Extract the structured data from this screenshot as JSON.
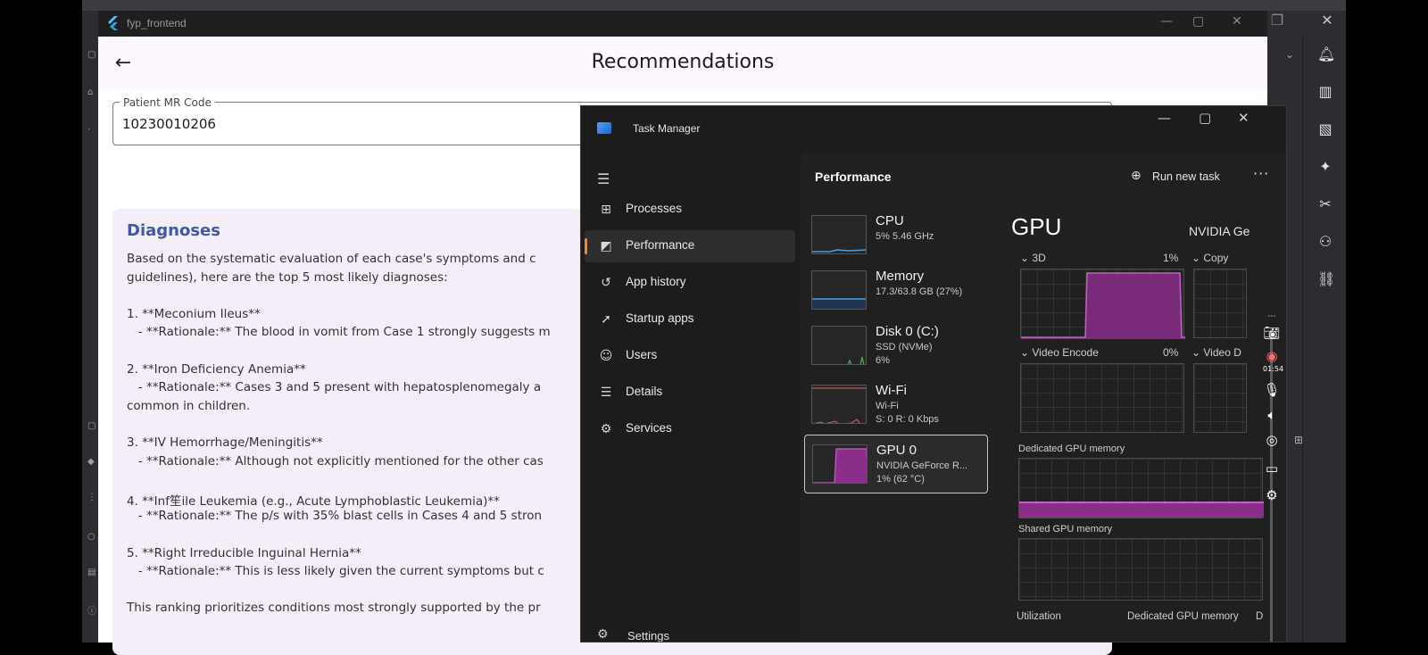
{
  "app": {
    "window_title": "fyp_frontend",
    "page_title": "Recommendations",
    "mr_code": {
      "label": "Patient MR Code",
      "value": "10230010206"
    },
    "diagnoses": {
      "title": "Diagnoses",
      "lines": [
        "Based on the systematic evaluation of each case's symptoms and c",
        "guidelines), here are the top 5 most likely diagnoses:",
        "",
        "1. **Meconium Ileus**",
        "   - **Rationale:** The blood in vomit from Case 1 strongly suggests m",
        "",
        "2. **Iron Deficiency Anemia**",
        "   - **Rationale:** Cases 3 and 5 present with hepatosplenomegaly a",
        "common in children.",
        "",
        "3. **IV Hemorrhage/Meningitis**",
        "   - **Rationale:** Although not explicitly mentioned for the other cas",
        "",
        "4. **Inf笙ile Leukemia (e.g., Acute Lymphoblastic Leukemia)**",
        "   - **Rationale:** The p/s with 35% blast cells in Cases 4 and 5 stron",
        "",
        "5. **Right Irreducible Inguinal Hernia**",
        "   - **Rationale:** This is less likely given the current symptoms but c",
        "",
        "This ranking prioritizes conditions most strongly supported by the pr"
      ]
    }
  },
  "task_manager": {
    "title": "Task Manager",
    "nav": [
      {
        "label": "Processes",
        "icon": "processes-icon",
        "glyph": "⊞",
        "selected": false
      },
      {
        "label": "Performance",
        "icon": "performance-icon",
        "glyph": "◩",
        "selected": true
      },
      {
        "label": "App history",
        "icon": "history-icon",
        "glyph": "↺",
        "selected": false
      },
      {
        "label": "Startup apps",
        "icon": "startup-icon",
        "glyph": "➚",
        "selected": false
      },
      {
        "label": "Users",
        "icon": "users-icon",
        "glyph": "☺",
        "selected": false
      },
      {
        "label": "Details",
        "icon": "details-icon",
        "glyph": "☰",
        "selected": false
      },
      {
        "label": "Services",
        "icon": "services-icon",
        "glyph": "⚙",
        "selected": false
      }
    ],
    "settings_label": "Settings",
    "performance": {
      "title": "Performance",
      "run_new_task": "Run new task",
      "resources": [
        {
          "name": "CPU",
          "sub1": "5% 5.46 GHz",
          "sub2": "",
          "sub3": "",
          "selected": false
        },
        {
          "name": "Memory",
          "sub1": "17.3/63.8 GB (27%)",
          "sub2": "",
          "sub3": "",
          "selected": false
        },
        {
          "name": "Disk 0 (C:)",
          "sub1": "SSD (NVMe)",
          "sub2": "6%",
          "sub3": "",
          "selected": false
        },
        {
          "name": "Wi-Fi",
          "sub1": "Wi-Fi",
          "sub2": "S: 0 R: 0 Kbps",
          "sub3": "",
          "selected": false
        },
        {
          "name": "GPU 0",
          "sub1": "NVIDIA GeForce R...",
          "sub2": "1% (62 °C)",
          "sub3": "",
          "selected": true
        }
      ],
      "gpu": {
        "heading": "GPU",
        "model": "NVIDIA Ge",
        "engine_3d": "3D",
        "engine_3d_pct": "1%",
        "engine_copy": "Copy",
        "engine_video_encode": "Video Encode",
        "engine_video_encode_pct": "0%",
        "engine_video_decode": "Video D",
        "dedicated_memory": "Dedicated GPU memory",
        "shared_memory": "Shared GPU memory",
        "footer_utilization": "Utilization",
        "footer_dedicated": "Dedicated GPU memory",
        "footer_trunc": "D"
      },
      "recorder_time": "01:54"
    }
  },
  "colors": {
    "gpu_purple": "#8a2e8a",
    "accent_orange": "#f08a30",
    "diagnoses_blue": "#3f5aa6"
  }
}
